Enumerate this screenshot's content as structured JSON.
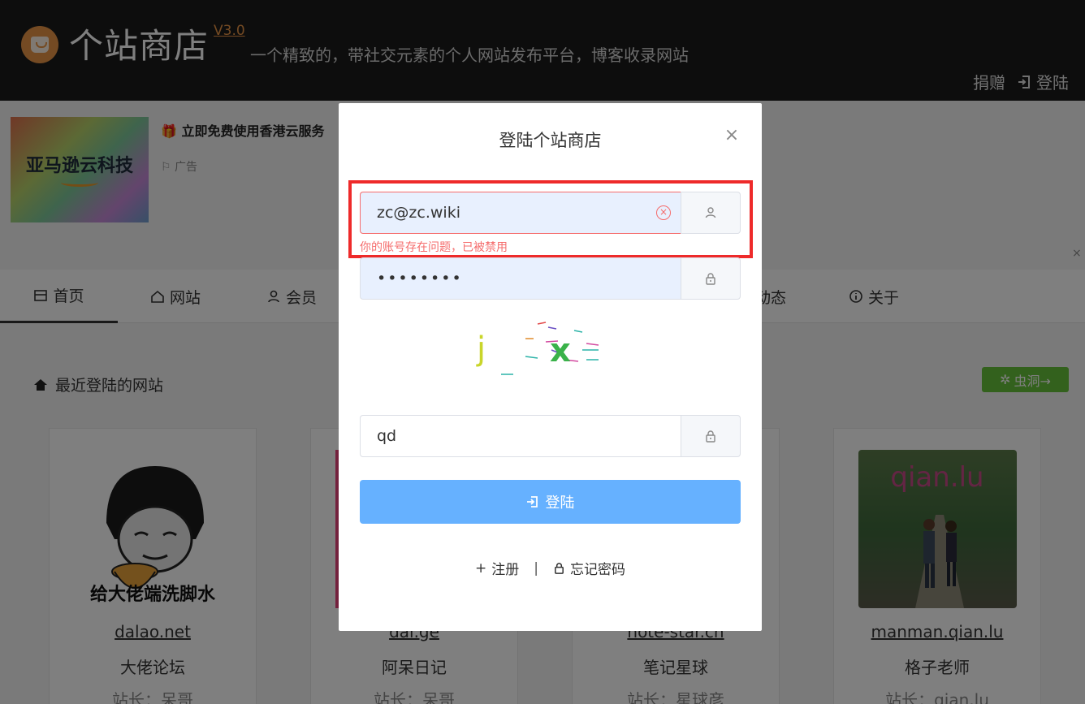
{
  "header": {
    "brand": "个站商店",
    "version": "V3.0",
    "slogan": "一个精致的，带社交元素的个人网站发布平台，博客收录网站",
    "donate": "捐赠",
    "login": "登陆"
  },
  "ad": {
    "image_text": "亚马逊云科技",
    "title": "🎁 立即免费使用香港云服务",
    "label": "广告",
    "close": "×"
  },
  "nav": {
    "items": [
      {
        "label": "首页"
      },
      {
        "label": "网站"
      },
      {
        "label": "会员"
      },
      {
        "label": "动态"
      },
      {
        "label": "关于"
      }
    ]
  },
  "section": {
    "title": "最近登陆的网站",
    "wormhole": "虫洞→"
  },
  "cards": [
    {
      "domain": "dalao.net",
      "name": "大佬论坛",
      "owner": "站长：呆哥",
      "img_text": "给大佬端洗脚水"
    },
    {
      "domain": "dai.ge",
      "name": "阿呆日记",
      "owner": "站长：呆哥"
    },
    {
      "domain": "note-star.cn",
      "name": "笔记星球",
      "owner": "站长：星球彦"
    },
    {
      "domain": "manman.qian.lu",
      "name": "格子老师",
      "owner": "站长：qian.lu",
      "img_text": "qian.lu"
    }
  ],
  "dialog": {
    "title": "登陆个站商店",
    "email_value": "zc@zc.wiki",
    "error": "你的账号存在问题，已被禁用",
    "password_value": "••••••••",
    "captcha_value": "qd",
    "captcha_text": "j x",
    "login_button": "登陆",
    "register": "注册",
    "forgot": "忘记密码",
    "separator": "|"
  }
}
